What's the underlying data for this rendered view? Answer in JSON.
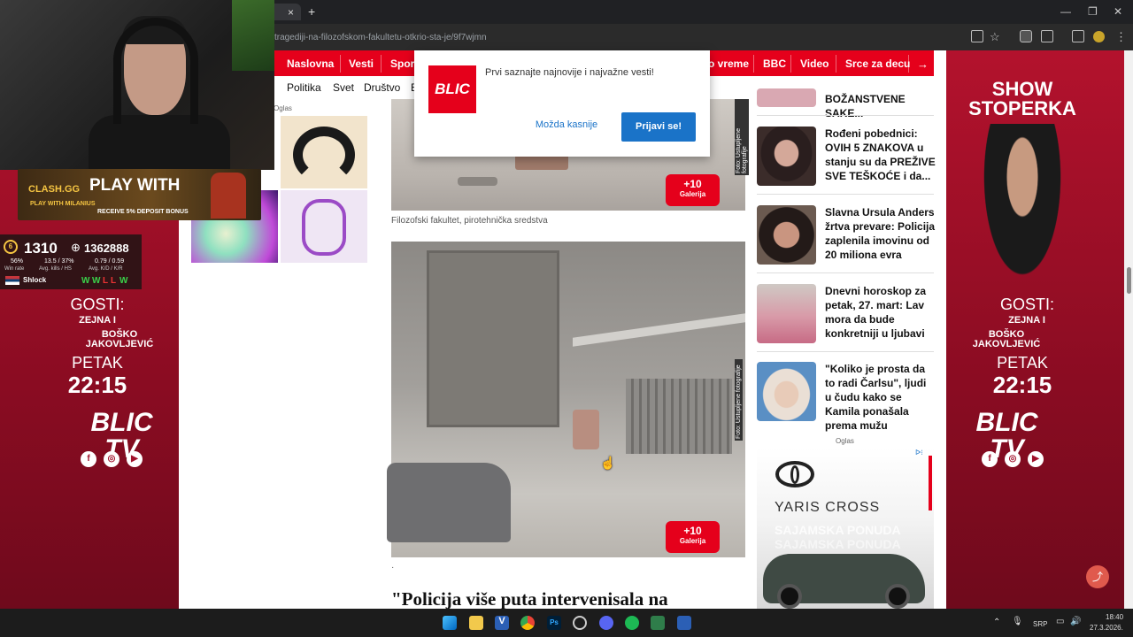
{
  "browser": {
    "tab_close": "×",
    "new_tab": "+",
    "url": "tragediji-na-filozofskom-fakultetu-otkrio-sta-je/9f7wjmn",
    "window_controls": [
      "—",
      "❐",
      "✕"
    ]
  },
  "nav": {
    "items": [
      "Naslovna",
      "Vesti",
      "Sport",
      "o vreme",
      "BBC",
      "Video",
      "Srce za decu"
    ],
    "arrow": "→",
    "sub_items": [
      "Politika",
      "Svet",
      "Društvo",
      "E"
    ]
  },
  "popup": {
    "logo": "BLIC",
    "message": "Prvi saznajte najnovije i najvažne vesti!",
    "later": "Možda kasnije",
    "subscribe": "Prijavi se!"
  },
  "ad_left": {
    "label": "Oglas"
  },
  "article": {
    "gallery1": {
      "count": "+10",
      "label": "Galerija"
    },
    "photo_credit": "Foto: Ustupljene fotografije",
    "caption": "Filozofski fakultet, pirotehnička sredstva",
    "gallery2": {
      "count": "+10",
      "label": "Galerija"
    },
    "dot": "·",
    "headline": "\"Policija više puta intervenisala na"
  },
  "sidebar": {
    "partial_title": "BOŽANSTVENE SAKE...",
    "items": [
      {
        "title": "Rođeni pobednici: OVIH 5 ZNAKOVA u stanju su da PREŽIVE SVE TEŠKOĆE i da..."
      },
      {
        "title": "Slavna Ursula Anders žrtva prevare: Policija zaplenila imovinu od 20 miliona evra"
      },
      {
        "title": "Dnevni horoskop za petak, 27. mart: Lav mora da bude konkretniji u ljubavi"
      },
      {
        "title": "\"Koliko je prosta da to radi Čarlsu\", ljudi u čudu kako se Kamila ponašala prema mužu"
      }
    ],
    "ad_label": "Oglas",
    "toyota_model": "YARIS CROSS",
    "toyota_promo": "SAJAMSKA PONUDA",
    "toyota_promo2": "SAJAMSKA PONUDA"
  },
  "banner": {
    "show1": "SHOW",
    "show2": "STOPERKA",
    "guests_label": "GOSTI:",
    "guest1": "ZEJNA I",
    "guest2": "BOŠKO JAKOVLJEVIĆ",
    "day": "PETAK",
    "time": "22:15",
    "brand": "BLIC TV",
    "social": [
      "f",
      "◎",
      "▶"
    ]
  },
  "stream": {
    "promo_brand": "CLASH.GG",
    "promo_title": "PLAY WITH",
    "promo_sub": "PLAY WITH MILANIUS",
    "promo_bonus": "RECEIVE 5% DEPOSIT BONUS",
    "level": "6",
    "elo": "1310",
    "points": "1362888",
    "stat_vals": [
      "56%",
      "13.5 / 37%",
      "0.79 / 0.59"
    ],
    "stat_labels": [
      "Win rate",
      "Avg. kills / HS",
      "Avg. K/D / K/R"
    ],
    "player": "Shlock",
    "results": [
      "W",
      "W",
      "L",
      "L",
      "W"
    ]
  },
  "taskbar": {
    "lang": "SRP",
    "time": "18:40",
    "date": "27.3.2026."
  },
  "colors": {
    "brand_red": "#e5001b",
    "button_blue": "#1a73c8",
    "banner_red": "#a0102a"
  }
}
